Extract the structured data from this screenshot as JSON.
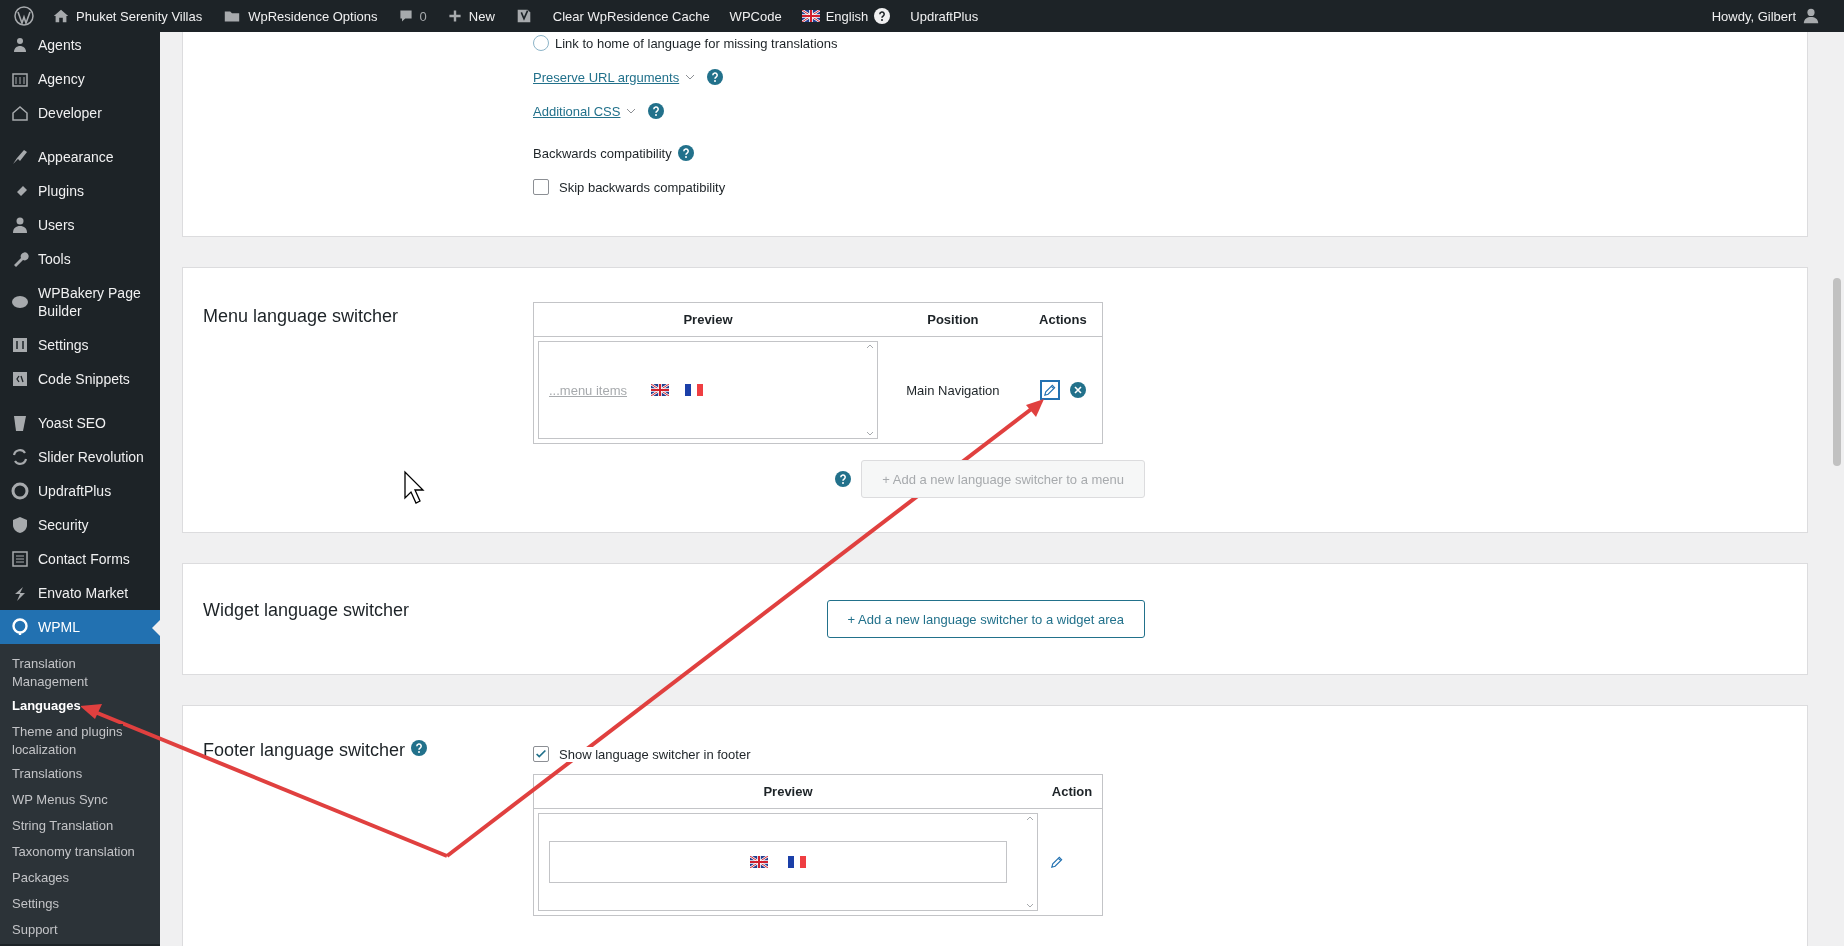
{
  "admin_bar": {
    "items": [
      {
        "kind": "site",
        "label": "Phuket Serenity Villas"
      },
      {
        "kind": "folder",
        "label": "WpResidence Options"
      },
      {
        "kind": "comments",
        "label": "0"
      },
      {
        "kind": "new",
        "label": "New"
      },
      {
        "kind": "yoast"
      },
      {
        "kind": "text",
        "label": "Clear WpResidence Cache"
      },
      {
        "kind": "text",
        "label": "WPCode"
      },
      {
        "kind": "language",
        "label": "English"
      },
      {
        "kind": "text",
        "label": "UpdraftPlus"
      }
    ],
    "account": "Howdy, Gilbert"
  },
  "sidebar": {
    "groups": [
      {
        "items": [
          {
            "label": "Agents",
            "selected": false
          },
          {
            "label": "Agency",
            "selected": false
          },
          {
            "label": "Developer",
            "selected": false
          }
        ]
      },
      {
        "items": [
          {
            "label": "Appearance",
            "selected": false
          },
          {
            "label": "Plugins",
            "selected": false
          },
          {
            "label": "Users",
            "selected": false
          },
          {
            "label": "Tools",
            "selected": false
          },
          {
            "label": "WPBakery Page Builder",
            "selected": false
          },
          {
            "label": "Settings",
            "selected": false
          },
          {
            "label": "Code Snippets",
            "selected": false
          }
        ]
      },
      {
        "items": [
          {
            "label": "Yoast SEO",
            "selected": false
          },
          {
            "label": "Slider Revolution",
            "selected": false
          },
          {
            "label": "UpdraftPlus",
            "selected": false
          },
          {
            "label": "Security",
            "selected": false
          },
          {
            "label": "Contact Forms",
            "selected": false
          },
          {
            "label": "Envato Market",
            "selected": false
          },
          {
            "label": "WPML",
            "selected": true
          }
        ]
      }
    ],
    "submenu": [
      {
        "label": "Translation Management",
        "selected": false
      },
      {
        "label": "Languages",
        "selected": true
      },
      {
        "label": "Theme and plugins localization",
        "selected": false
      },
      {
        "label": "Translations",
        "selected": false
      },
      {
        "label": "WP Menus Sync",
        "selected": false
      },
      {
        "label": "String Translation",
        "selected": false
      },
      {
        "label": "Taxonomy translation",
        "selected": false
      },
      {
        "label": "Packages",
        "selected": false
      },
      {
        "label": "Settings",
        "selected": false
      },
      {
        "label": "Support",
        "selected": false
      }
    ]
  },
  "options_section": {
    "options": [
      {
        "kind": "radio",
        "label": "Link to home of language for missing translations",
        "checked": false,
        "help": false
      },
      {
        "kind": "link",
        "label": "Preserve URL arguments",
        "expanded": false,
        "help": true
      },
      {
        "kind": "link",
        "label": "Additional CSS",
        "expanded": false,
        "help": true
      },
      {
        "kind": "heading",
        "label": "Backwards compatibility",
        "help": true
      },
      {
        "kind": "checkbox",
        "label": "Skip backwards compatibility",
        "checked": false,
        "help": false
      }
    ]
  },
  "menu_switcher": {
    "title": "Menu language switcher",
    "columns": [
      "Preview",
      "Position",
      "Actions"
    ],
    "rows": [
      {
        "preview_link": "...menu items",
        "position": "Main Navigation",
        "edit_focused": true
      }
    ],
    "add_button": {
      "label": "+ Add a new language switcher to a menu",
      "disabled": true
    }
  },
  "widget_switcher": {
    "title": "Widget language switcher",
    "add_button": {
      "label": "+ Add a new language switcher to a widget area",
      "disabled": false
    }
  },
  "footer_switcher": {
    "title": "Footer language switcher",
    "help": true,
    "show_checkbox": {
      "label": "Show language switcher in footer",
      "checked": true
    },
    "columns": [
      "Preview",
      "Action"
    ]
  }
}
